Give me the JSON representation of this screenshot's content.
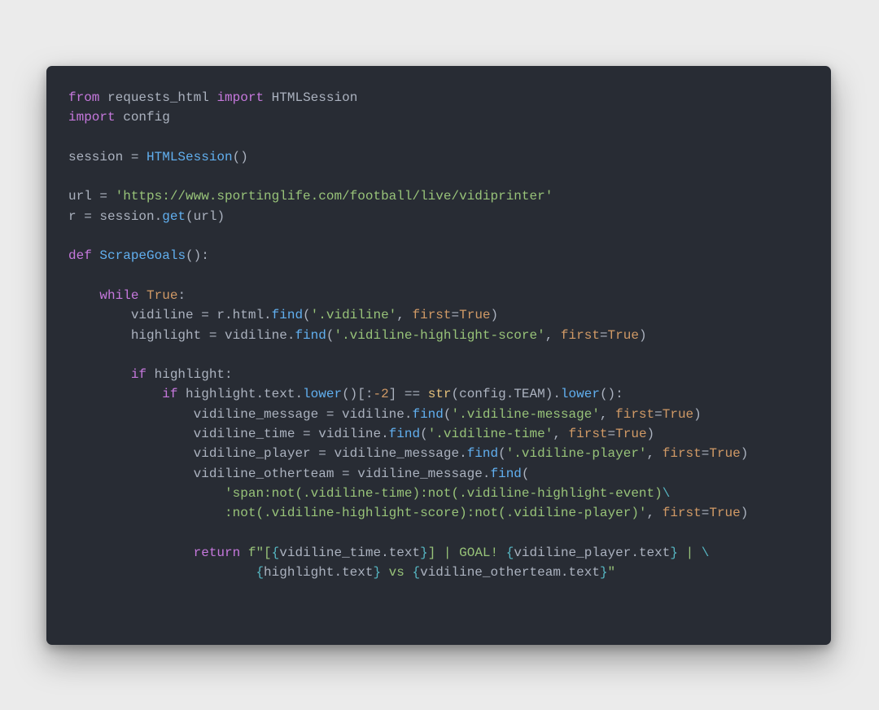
{
  "code": {
    "line1": {
      "from": "from",
      "mod": "requests_html",
      "import": "import",
      "cls": "HTMLSession"
    },
    "line2": {
      "import": "import",
      "mod": "config"
    },
    "line4": {
      "lhs": "session = ",
      "call": "HTMLSession",
      "paren": "()"
    },
    "line6": {
      "lhs": "url = ",
      "str": "'https://www.sportinglife.com/football/live/vidiprinter'"
    },
    "line7": {
      "txt": "r = session.",
      "call": "get",
      "open": "(url)"
    },
    "line9": {
      "def": "def",
      "name": "ScrapeGoals",
      "paren": "():"
    },
    "line11": {
      "while": "while",
      "true": "True",
      "colon": ":"
    },
    "line12": {
      "pre": "        vidiline = r.html.",
      "call": "find",
      "open": "(",
      "str": "'.vidiline'",
      "comma": ", ",
      "kw": "first",
      "eq": "=",
      "true": "True",
      "close": ")"
    },
    "line13": {
      "pre": "        highlight = vidiline.",
      "call": "find",
      "open": "(",
      "str": "'.vidiline-highlight-score'",
      "comma": ", ",
      "kw": "first",
      "eq": "=",
      "true": "True",
      "close": ")"
    },
    "line15": {
      "if": "if",
      "txt": " highlight:"
    },
    "line16": {
      "if": "if",
      "pre": " highlight.text.",
      "call": "lower",
      "open": "()[:",
      "neg": "-2",
      "close": "] == ",
      "str_b": "str",
      "open2": "(config.TEAM).",
      "call2": "lower",
      "close2": "():"
    },
    "line17": {
      "pre": "                vidiline_message = vidiline.",
      "call": "find",
      "open": "(",
      "str": "'.vidiline-message'",
      "comma": ", ",
      "kw": "first",
      "eq": "=",
      "true": "True",
      "close": ")"
    },
    "line18": {
      "pre": "                vidiline_time = vidiline.",
      "call": "find",
      "open": "(",
      "str": "'.vidiline-time'",
      "comma": ", ",
      "kw": "first",
      "eq": "=",
      "true": "True",
      "close": ")"
    },
    "line19": {
      "pre": "                vidiline_player = vidiline_message.",
      "call": "find",
      "open": "(",
      "str": "'.vidiline-player'",
      "comma": ", ",
      "kw": "first",
      "eq": "=",
      "true": "True",
      "close": ")"
    },
    "line20": {
      "pre": "                vidiline_otherteam = vidiline_message.",
      "call": "find",
      "open": "("
    },
    "line21": {
      "str": "'span:not(.vidiline-time):not(.vidiline-highlight-event)",
      "esc": "\\"
    },
    "line22": {
      "str": "                    :not(.vidiline-highlight-score):not(.vidiline-player)'",
      "comma": ", ",
      "kw": "first",
      "eq": "=",
      "true": "True",
      "close": ")"
    },
    "line24": {
      "return": "return",
      "f": " f",
      "q": "\"",
      "open": "[",
      "b1o": "{",
      "e1": "vidiline_time.text",
      "b1c": "}",
      "mid": "] | GOAL! ",
      "b2o": "{",
      "e2": "vidiline_player.text",
      "b2c": "}",
      "mid2": " | ",
      "esc": "\\"
    },
    "line25": {
      "b3o": "{",
      "e3": "highlight.text",
      "b3c": "}",
      "mid": " vs ",
      "b4o": "{",
      "e4": "vidiline_otherteam.text",
      "b4c": "}",
      "q": "\""
    }
  }
}
